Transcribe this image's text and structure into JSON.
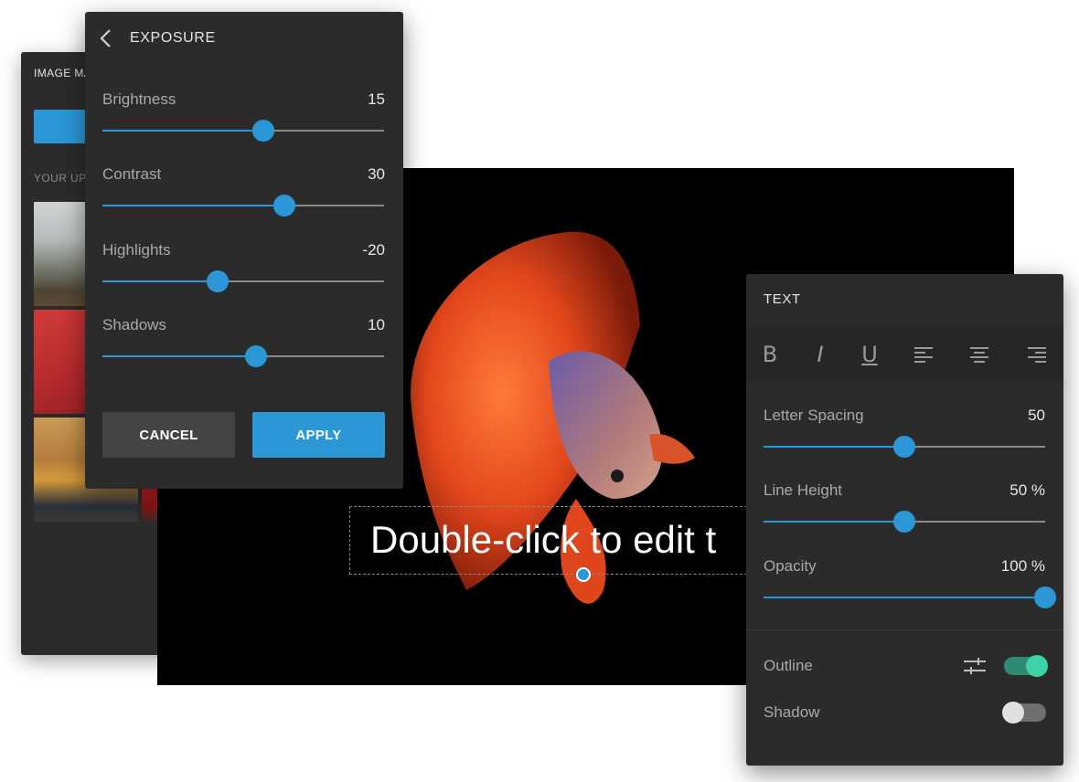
{
  "image_manager": {
    "title": "IMAGE MA",
    "uploads_label": "YOUR UP",
    "thumbnails": [
      "mountain-forest",
      "succulent",
      "woman-red-chair",
      "dark-teal",
      "yellow-taxi-street",
      "red-classic-car"
    ]
  },
  "canvas": {
    "text": "Double-click to edit t"
  },
  "exposure": {
    "title": "EXPOSURE",
    "sliders": [
      {
        "label": "Brightness",
        "value": "15",
        "fraction": 0.57
      },
      {
        "label": "Contrast",
        "value": "30",
        "fraction": 0.645
      },
      {
        "label": "Highlights",
        "value": "-20",
        "fraction": 0.41
      },
      {
        "label": "Shadows",
        "value": "10",
        "fraction": 0.545
      }
    ],
    "cancel_label": "CANCEL",
    "apply_label": "APPLY"
  },
  "text_panel": {
    "title": "TEXT",
    "format_icons": [
      "bold-icon",
      "italic-icon",
      "underline-icon",
      "align-left-icon",
      "align-center-icon",
      "align-right-icon"
    ],
    "format_glyphs": {
      "bold": "B",
      "italic": "I",
      "underline": "U"
    },
    "sliders": [
      {
        "label": "Letter Spacing",
        "value": "50",
        "fraction": 0.5
      },
      {
        "label": "Line Height",
        "value": "50 %",
        "fraction": 0.5
      },
      {
        "label": "Opacity",
        "value": "100 %",
        "fraction": 1.0
      }
    ],
    "outline_label": "Outline",
    "outline_on": true,
    "shadow_label": "Shadow",
    "shadow_on": false
  },
  "colors": {
    "accent": "#2b97d6",
    "panel_bg": "#2b2b2b",
    "toggle_on": "#3dd3a6"
  }
}
